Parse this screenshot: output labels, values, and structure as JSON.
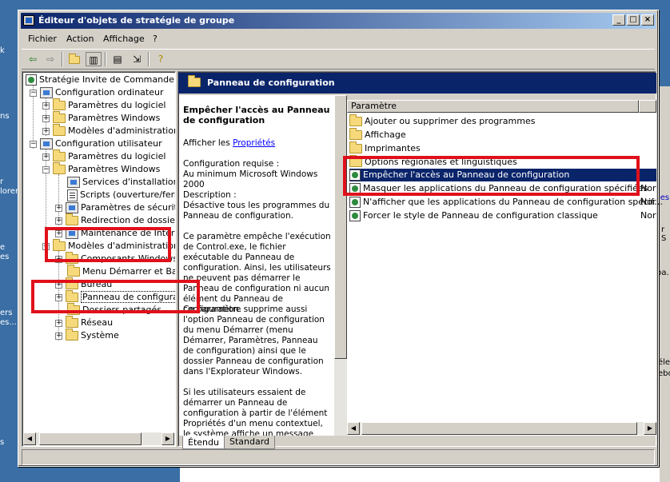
{
  "window": {
    "title": "Éditeur d'objets de stratégie de groupe"
  },
  "menu": [
    "Fichier",
    "Action",
    "Affichage",
    "?"
  ],
  "tree": {
    "items": [
      {
        "label": "Stratégie Invite de Commande et F",
        "icon": "policy-icon"
      },
      {
        "label": "Configuration ordinateur",
        "icon": "computer-icon"
      },
      {
        "label": "Paramètres du logiciel",
        "icon": "folder-icon"
      },
      {
        "label": "Paramètres Windows",
        "icon": "folder-icon"
      },
      {
        "label": "Modèles d'administration",
        "icon": "folder-icon"
      },
      {
        "label": "Configuration utilisateur",
        "icon": "user-icon"
      },
      {
        "label": "Paramètres du logiciel",
        "icon": "folder-icon"
      },
      {
        "label": "Paramètres Windows",
        "icon": "folder-icon"
      },
      {
        "label": "Services d'installation à",
        "icon": "gear-icon"
      },
      {
        "label": "Scripts (ouverture/ferm",
        "icon": "script-icon"
      },
      {
        "label": "Paramètres de sécurité",
        "icon": "lock-icon"
      },
      {
        "label": "Redirection de dossiers",
        "icon": "folder-icon"
      },
      {
        "label": "Maintenance de Intern",
        "icon": "ie-icon"
      },
      {
        "label": "Modèles d'administration",
        "icon": "folder-icon"
      },
      {
        "label": "Composants Windows",
        "icon": "folder-icon"
      },
      {
        "label": "Menu Démarrer et Barr",
        "icon": "folder-icon"
      },
      {
        "label": "Bureau",
        "icon": "folder-icon"
      },
      {
        "label": "Panneau de configurat",
        "icon": "folder-icon"
      },
      {
        "label": "Dossiers partagés",
        "icon": "folder-icon"
      },
      {
        "label": "Réseau",
        "icon": "folder-icon"
      },
      {
        "label": "Système",
        "icon": "folder-icon"
      }
    ]
  },
  "header": {
    "title": "Panneau de configuration"
  },
  "description": {
    "setting_title": "Empêcher l'accès au Panneau de configuration",
    "show_prefix": "Afficher les ",
    "properties_link": "Propriétés",
    "req_label": "Configuration requise :",
    "req_value": "Au minimum Microsoft Windows 2000",
    "desc_label": "Description :",
    "desc_p1": "Désactive tous les programmes du Panneau de configuration.",
    "desc_p2": "Ce paramètre empêche l'exécution de Control.exe, le fichier exécutable du Panneau de configuration. Ainsi, les utilisateurs ne peuvent pas démarrer le Panneau de configuration ni aucun élément du Panneau de configuration.",
    "desc_p3": "Ce paramètre supprime aussi l'option Panneau de configuration du menu Démarrer (menu Démarrer, Paramètres, Panneau de configuration) ainsi que le dossier Panneau de configuration dans l'Explorateur Windows.",
    "desc_p4": "Si les utilisateurs essaient de démarrer un Panneau de configuration à partir de l'élément Propriétés d'un menu contextuel, le système affiche un message"
  },
  "list": {
    "column": "Paramètre",
    "items": [
      {
        "label": "Ajouter ou supprimer des programmes",
        "icon": "folder-icon",
        "state": ""
      },
      {
        "label": "Affichage",
        "icon": "folder-icon",
        "state": ""
      },
      {
        "label": "Imprimantes",
        "icon": "folder-icon",
        "state": ""
      },
      {
        "label": "Options régionales et linguistiques",
        "icon": "folder-icon",
        "state": ""
      },
      {
        "label": "Empêcher l'accès au Panneau de configuration",
        "icon": "policy-icon",
        "state": "",
        "selected": true
      },
      {
        "label": "Masquer les applications du Panneau de configuration spécifiées",
        "icon": "policy-icon",
        "state": "Nor"
      },
      {
        "label": "N'afficher que les applications du Panneau de configuration spécif…",
        "icon": "policy-icon",
        "state": "Nor"
      },
      {
        "label": "Forcer le style de Panneau de configuration classique",
        "icon": "policy-icon",
        "state": "Nor"
      }
    ]
  },
  "tabs": [
    "Étendu",
    "Standard"
  ],
  "desktop": {
    "left_fragments": [
      "k",
      "ns",
      "r",
      "lorer",
      "e",
      "es",
      "ers",
      "es...",
      "s"
    ],
    "right_fragments": [
      "les",
      "r S",
      "pa.",
      "éle",
      "ebo"
    ]
  }
}
